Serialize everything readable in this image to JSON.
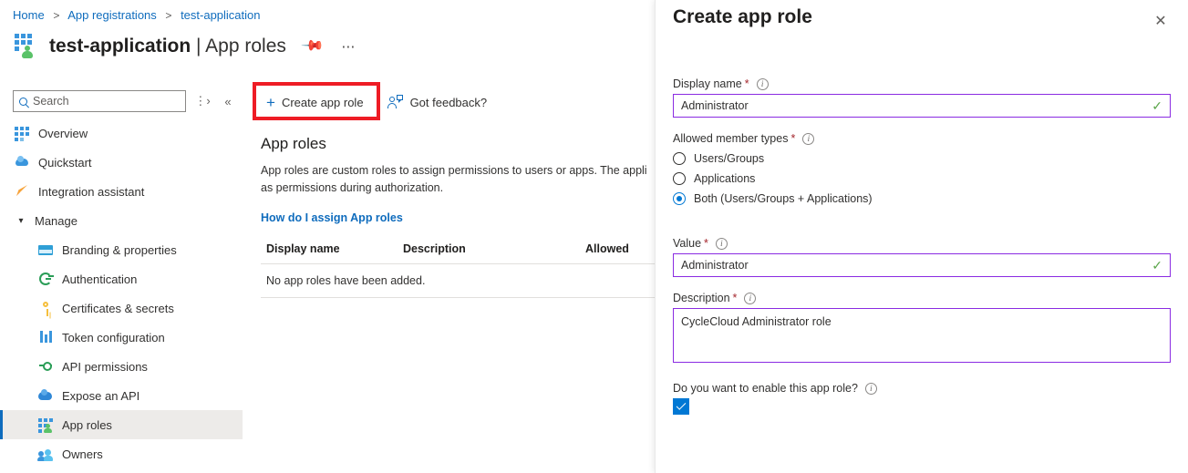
{
  "breadcrumb": {
    "items": [
      "Home",
      "App registrations",
      "test-application"
    ],
    "separator": ">"
  },
  "header": {
    "title_main": "test-application",
    "title_divider": " | ",
    "title_section": "App roles",
    "pin_icon": "pin-icon",
    "more_icon": "ellipsis-icon",
    "app_icon": "app-registration-icon"
  },
  "search": {
    "placeholder": "Search",
    "icon": "search-icon",
    "collapse_all_icon": "collapse-all-icon",
    "hide_pane_icon": "double-chevron-left-icon"
  },
  "sidebar": {
    "items": [
      {
        "label": "Overview",
        "icon": "overview-grid-icon",
        "level": 0,
        "selected": false
      },
      {
        "label": "Quickstart",
        "icon": "quickstart-cloud-icon",
        "level": 0,
        "selected": false
      },
      {
        "label": "Integration assistant",
        "icon": "rocket-icon",
        "level": 0,
        "selected": false
      },
      {
        "label": "Manage",
        "icon": "chevron-down-icon",
        "level": 0,
        "selected": false,
        "group": true
      },
      {
        "label": "Branding & properties",
        "icon": "branding-card-icon",
        "level": 1,
        "selected": false
      },
      {
        "label": "Authentication",
        "icon": "authentication-icon",
        "level": 1,
        "selected": false
      },
      {
        "label": "Certificates & secrets",
        "icon": "key-icon",
        "level": 1,
        "selected": false
      },
      {
        "label": "Token configuration",
        "icon": "token-bars-icon",
        "level": 1,
        "selected": false
      },
      {
        "label": "API permissions",
        "icon": "api-permissions-icon",
        "level": 1,
        "selected": false
      },
      {
        "label": "Expose an API",
        "icon": "expose-api-cloud-icon",
        "level": 1,
        "selected": false
      },
      {
        "label": "App roles",
        "icon": "app-roles-icon",
        "level": 1,
        "selected": true
      },
      {
        "label": "Owners",
        "icon": "owners-people-icon",
        "level": 1,
        "selected": false
      }
    ]
  },
  "command_bar": {
    "create_label": "Create app role",
    "create_icon": "plus-icon",
    "feedback_label": "Got feedback?",
    "feedback_icon": "feedback-person-icon",
    "highlight_color": "#ee1c25"
  },
  "main": {
    "heading": "App roles",
    "description": "App roles are custom roles to assign permissions to users or apps. The appli… as permissions during authorization.",
    "description_line1": "App roles are custom roles to assign permissions to users or apps. The appli",
    "description_line2": "as permissions during authorization.",
    "help_link": "How do I assign App roles",
    "table": {
      "columns": [
        "Display name",
        "Description",
        "Allowed"
      ],
      "empty_message": "No app roles have been added."
    }
  },
  "panel": {
    "title": "Create app role",
    "close_icon": "close-icon",
    "info_icon": "info-icon",
    "required_marker": "*",
    "display_name": {
      "label": "Display name",
      "value": "Administrator",
      "valid_icon": "checkmark-icon",
      "border_color": "#8a2be2"
    },
    "allowed_member_types": {
      "label": "Allowed member types",
      "options": [
        {
          "label": "Users/Groups",
          "selected": false
        },
        {
          "label": "Applications",
          "selected": false
        },
        {
          "label": "Both (Users/Groups + Applications)",
          "selected": true
        }
      ],
      "accent_color": "#0078d4"
    },
    "value_field": {
      "label": "Value",
      "value": "Administrator",
      "valid_icon": "checkmark-icon"
    },
    "description_field": {
      "label": "Description",
      "value": "CycleCloud Administrator role"
    },
    "enable_toggle": {
      "label": "Do you want to enable this app role?",
      "checked": true,
      "checkbox_icon": "checkbox-checked-icon"
    }
  }
}
